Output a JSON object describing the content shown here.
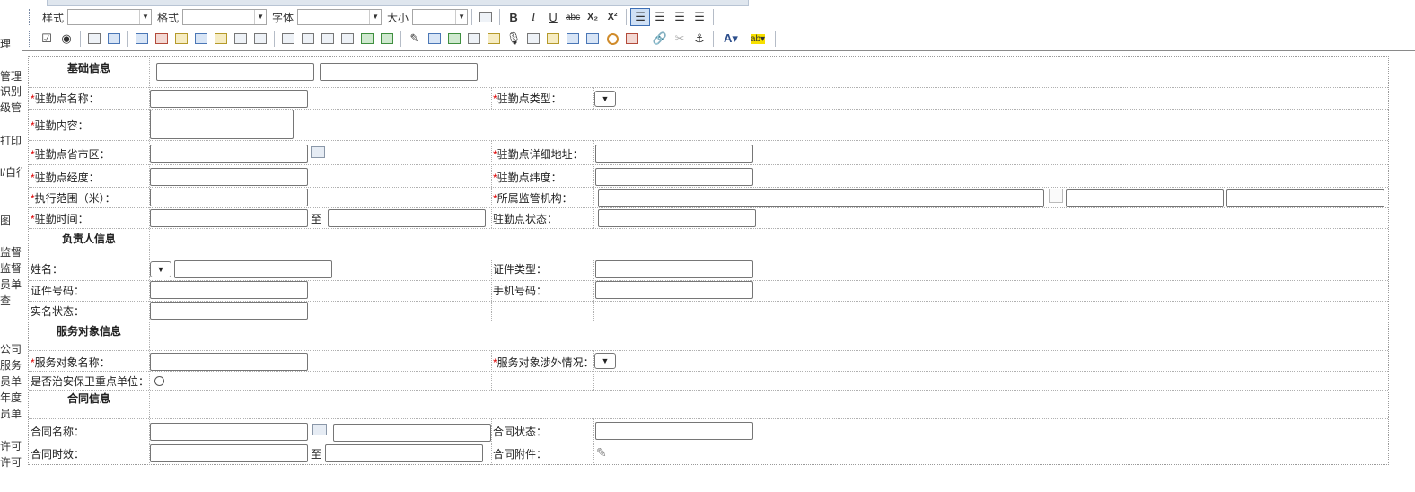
{
  "leftnav": [
    "理",
    "管理",
    "识别",
    "级管",
    "打印",
    "l/自行",
    "图",
    "监督",
    "监督",
    "员单",
    "查",
    "公司",
    "服务",
    "员单",
    "年度",
    "员单",
    "许可",
    "许可"
  ],
  "toolbar": {
    "style_label": "样式",
    "format_label": "格式",
    "font_label": "字体",
    "size_label": "大小",
    "bold": "B",
    "italic": "I",
    "underline": "U",
    "strike": "abc",
    "subscript": "X₂",
    "superscript": "X²"
  },
  "form": {
    "section_basic": "基础信息",
    "station_name": "驻勤点名称：",
    "station_type": "驻勤点类型：",
    "station_content": "驻勤内容：",
    "station_region": "驻勤点省市区：",
    "station_address": "驻勤点详细地址：",
    "station_lng": "驻勤点经度：",
    "station_lat": "驻勤点纬度：",
    "exec_range": "执行范围（米）：",
    "supervisor_org": "所属监管机构：",
    "station_time": "驻勤时间：",
    "to1": "至",
    "station_status": "驻勤点状态：",
    "section_person": "负责人信息",
    "name": "姓名：",
    "cert_type": "证件类型：",
    "cert_no": "证件号码：",
    "phone": "手机号码：",
    "realname_status": "实名状态：",
    "section_service": "服务对象信息",
    "service_name": "服务对象名称：",
    "service_foreign": "服务对象涉外情况：",
    "key_unit": "是否治安保卫重点单位：",
    "section_contract": "合同信息",
    "contract_name": "合同名称：",
    "contract_status": "合同状态：",
    "contract_period": "合同时效：",
    "to2": "至",
    "contract_attach": "合同附件："
  }
}
